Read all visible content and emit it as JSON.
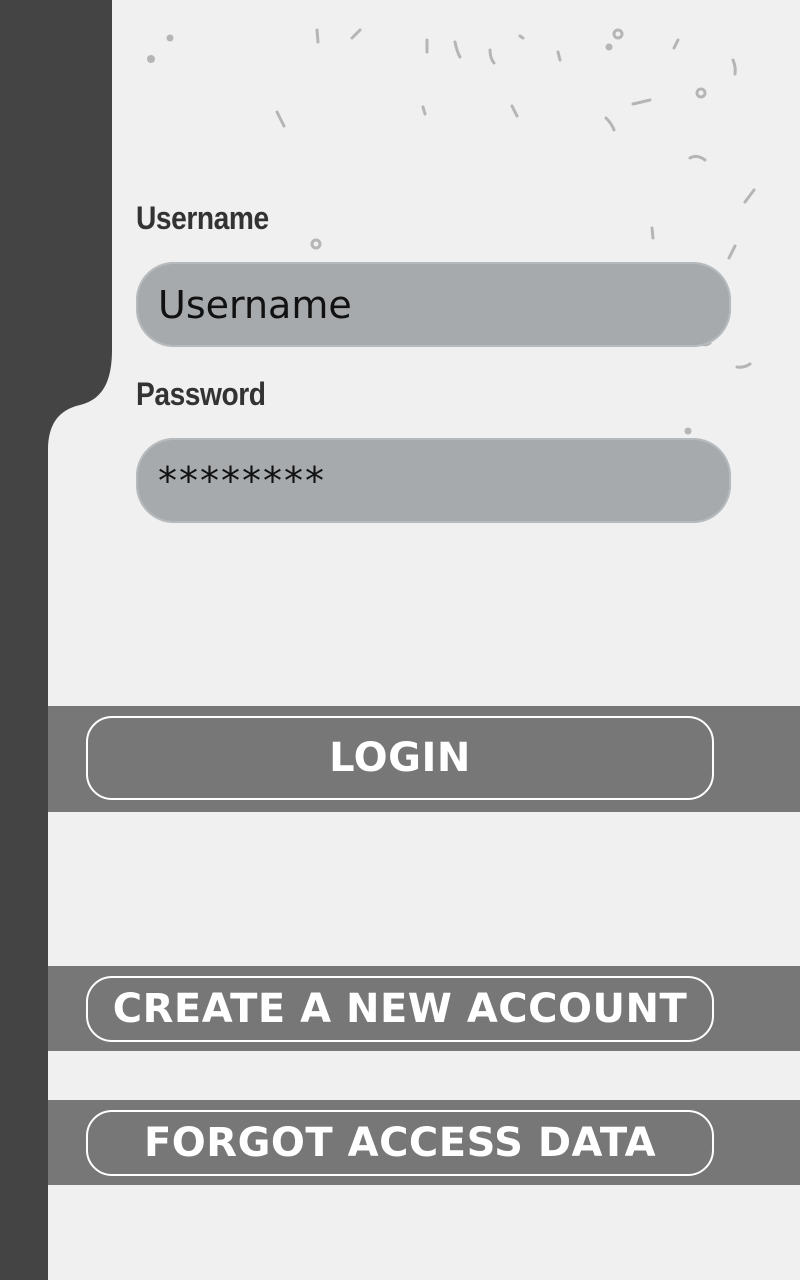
{
  "form": {
    "username_label": "Username",
    "username_value": "Username",
    "password_label": "Password",
    "password_value": "********"
  },
  "actions": {
    "login_label": "LOGIN",
    "create_account_label": "CREATE A NEW ACCOUNT",
    "forgot_label": "FORGOT ACCESS DATA"
  },
  "colors": {
    "sidebar": "#444444",
    "background": "#f0f0f0",
    "field": "#a7aaad",
    "button_band": "#777777",
    "button_text": "#ffffff"
  }
}
